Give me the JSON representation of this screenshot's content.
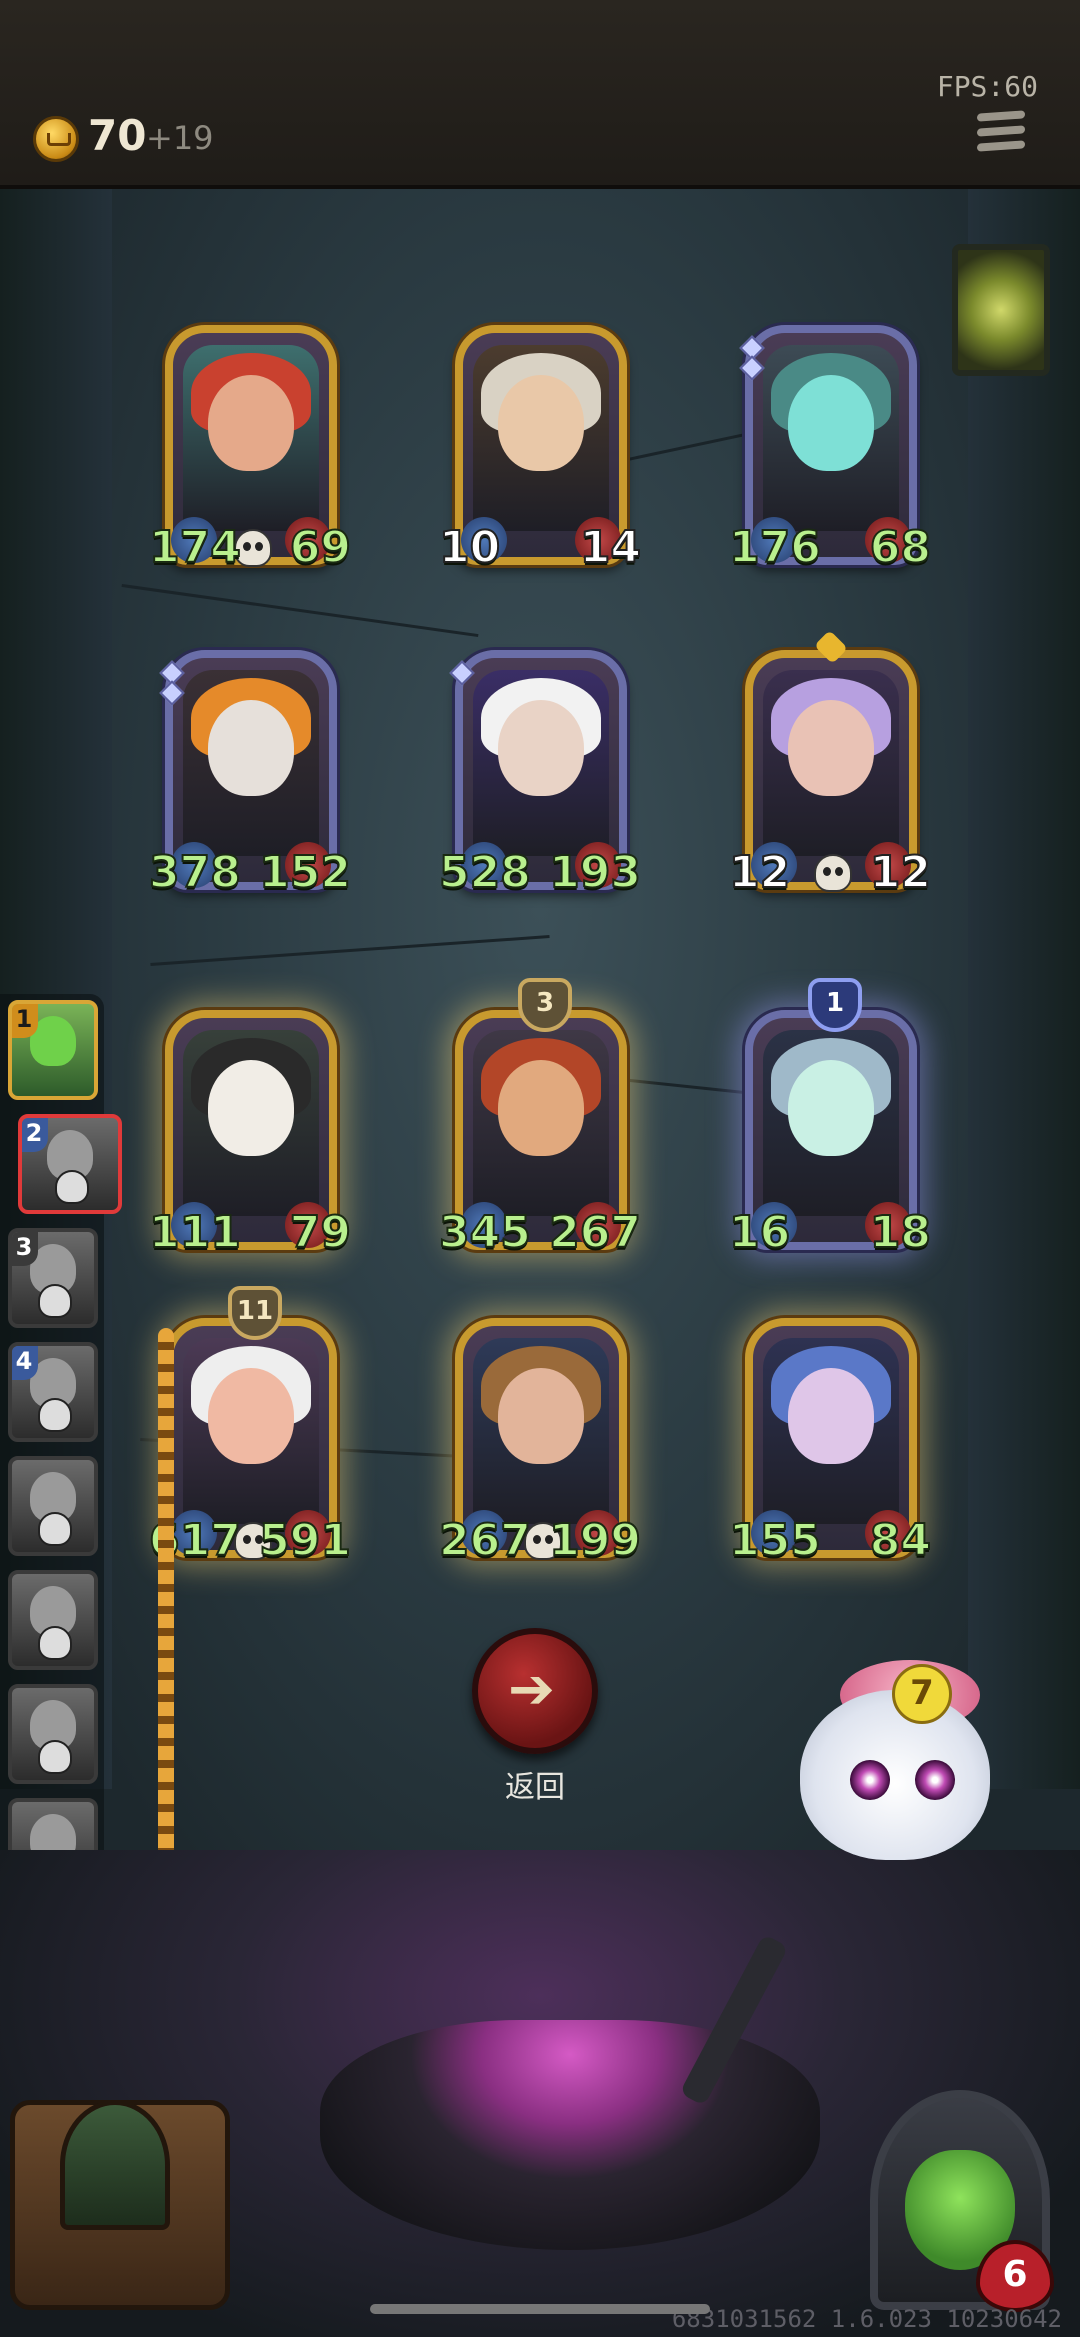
{
  "top_bar": {
    "gold": "70",
    "gold_income": "+19",
    "fps": "FPS:60",
    "icons": [
      "crown-coin-icon",
      "menu-icon"
    ]
  },
  "board": {
    "heroes": [
      {
        "row": 1,
        "col": 1,
        "attack": "174",
        "health": "69",
        "frame": "gold",
        "skull": true
      },
      {
        "row": 1,
        "col": 2,
        "attack": "10",
        "health": "14",
        "frame": "gold",
        "stats_color": "white"
      },
      {
        "row": 1,
        "col": 3,
        "attack": "176",
        "health": "68",
        "frame": "silver",
        "gems": 2
      },
      {
        "row": 2,
        "col": 1,
        "attack": "378",
        "health": "152",
        "frame": "silver",
        "gems": 2
      },
      {
        "row": 2,
        "col": 2,
        "attack": "528",
        "health": "193",
        "frame": "silver",
        "gems": 1
      },
      {
        "row": 2,
        "col": 3,
        "attack": "12",
        "health": "12",
        "frame": "gold",
        "stats_color": "white",
        "skull": true,
        "crown": "heart"
      },
      {
        "row": 3,
        "col": 1,
        "attack": "111",
        "health": "79",
        "frame": "gold",
        "glow": true
      },
      {
        "row": 3,
        "col": 2,
        "attack": "345",
        "health": "267",
        "frame": "gold",
        "glow": true,
        "level": "3"
      },
      {
        "row": 3,
        "col": 3,
        "attack": "16",
        "health": "18",
        "frame": "silver",
        "glow": true,
        "level": "1"
      },
      {
        "row": 4,
        "col": 1,
        "attack": "617",
        "health": "591",
        "frame": "gold",
        "glow": true,
        "level": "11",
        "skull": true
      },
      {
        "row": 4,
        "col": 2,
        "attack": "267",
        "health": "199",
        "frame": "gold",
        "glow": true,
        "skull": true
      },
      {
        "row": 4,
        "col": 3,
        "attack": "155",
        "health": "84",
        "frame": "gold",
        "glow": true
      }
    ]
  },
  "queue": {
    "slots": [
      {
        "num": "1",
        "state": "active"
      },
      {
        "num": "2",
        "state": "selected"
      },
      {
        "num": "3",
        "state": "idle"
      },
      {
        "num": "4",
        "state": "idle"
      },
      {
        "num": "",
        "state": "idle"
      },
      {
        "num": "",
        "state": "idle"
      },
      {
        "num": "",
        "state": "idle"
      },
      {
        "num": "",
        "state": "idle"
      }
    ]
  },
  "back_button": {
    "label": "返回",
    "icon": "arrow-left-icon"
  },
  "pet": {
    "badge": "7"
  },
  "player": {
    "health": "6",
    "icon": "heart-icon"
  },
  "build_id": "6831031562 1.6.023 10230642",
  "colors": {
    "atk": "#4f78b8",
    "hp": "#c24848",
    "stat_text": "#b9f08e",
    "gold_frame": "#c89a2e",
    "silver_frame": "#6a6ea8"
  }
}
